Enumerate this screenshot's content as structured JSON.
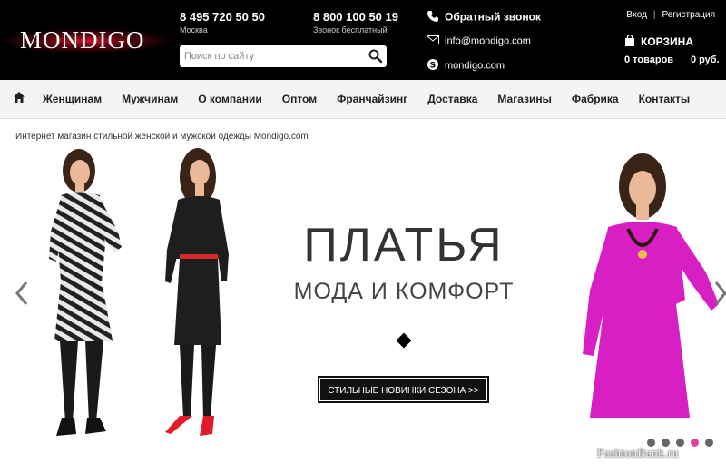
{
  "brand": {
    "name": "MONDIGO"
  },
  "phones": [
    {
      "number": "8 495 720 50 50",
      "label": "Москва"
    },
    {
      "number": "8 800 100 50 19",
      "label": "Звонок бесплатный"
    }
  ],
  "search": {
    "placeholder": "Поиск по сайту",
    "icon": "search-icon"
  },
  "contacts": {
    "callback": "Обратный звонок",
    "email": "info@mondigo.com",
    "skype": "mondigo.com"
  },
  "auth": {
    "login": "Вход",
    "register": "Регистрация"
  },
  "cart": {
    "title": "КОРЗИНА",
    "items": "0 товаров",
    "total": "0 руб."
  },
  "nav": {
    "home_icon": "home-icon",
    "items": [
      "Женщинам",
      "Мужчинам",
      "О компании",
      "Оптом",
      "Франчайзинг",
      "Доставка",
      "Магазины",
      "Фабрика",
      "Контакты"
    ]
  },
  "tagline": "Интернет магазин стильной женской и мужской одежды Mondigo.com",
  "banner": {
    "headline": "ПЛАТЬЯ",
    "subheadline": "МОДА И КОМФОРТ",
    "cta": "СТИЛЬНЫЕ НОВИНКИ СЕЗОНА >>",
    "slides": 5,
    "active_slide": 4,
    "watermark": "FashionBank.ru"
  },
  "colors": {
    "header_bg": "#000000",
    "accent_red": "#c8102e",
    "active_dot": "#e33fa0",
    "dress_magenta": "#d81fc4"
  }
}
